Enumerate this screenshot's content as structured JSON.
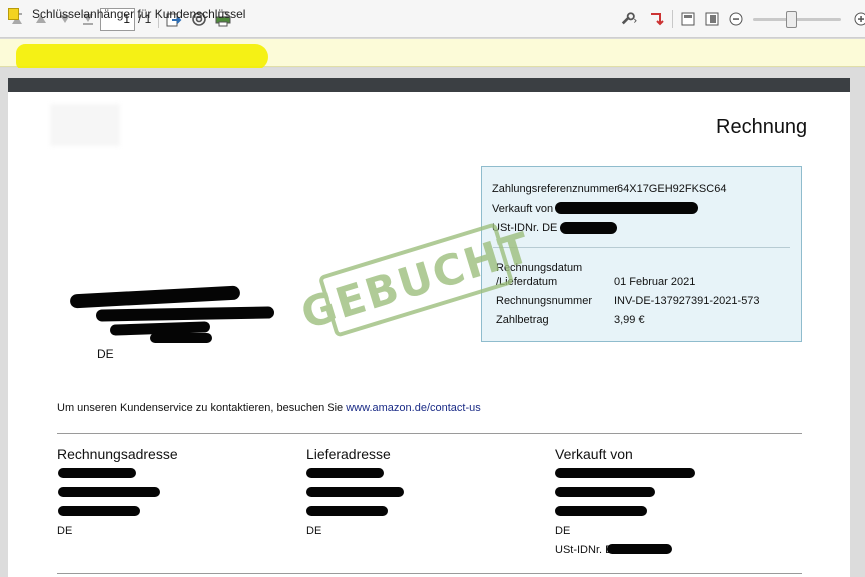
{
  "toolbar": {
    "page_current": "1",
    "page_total": "/ 1"
  },
  "note": {
    "text": "Schlüsselanhänger für Kundenschlüssel"
  },
  "document": {
    "title": "Rechnung",
    "info": {
      "payment_ref_label": "Zahlungsreferenznummer",
      "payment_ref_value": "64X17GEH92FKSC64",
      "sold_by_label": "Verkauft von",
      "vat_label": "USt-IDNr. DE",
      "invoice_date_label_1": "Rechnungsdatum",
      "invoice_date_label_2": "/Lieferdatum",
      "invoice_date_value": "01 Februar 2021",
      "invoice_number_label": "Rechnungsnummer",
      "invoice_number_value": "INV-DE-137927391-2021-573",
      "amount_label": "Zahlbetrag",
      "amount_value": "3,99 €"
    },
    "stamp": "GEBUCHT",
    "customer_country": "DE",
    "service_text": "Um unseren Kundenservice zu kontaktieren, besuchen Sie",
    "service_link": "www.amazon.de/contact-us",
    "columns": {
      "billing": {
        "heading": "Rechnungsadresse",
        "country": "DE"
      },
      "shipping": {
        "heading": "Lieferadresse",
        "country": "DE"
      },
      "seller": {
        "heading": "Verkauft von",
        "country": "DE",
        "vat_label": "USt-IDNr. DE"
      }
    }
  }
}
